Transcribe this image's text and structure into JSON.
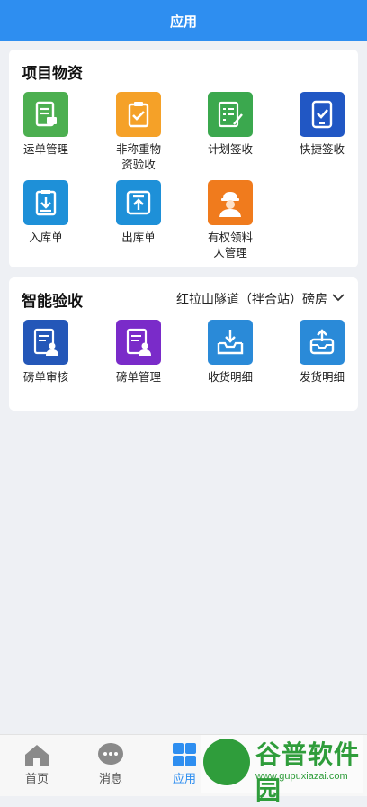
{
  "header": {
    "title": "应用"
  },
  "project_section": {
    "title": "项目物资",
    "items": [
      {
        "label": "运单管理",
        "icon": "waybill-icon",
        "color": "#4caf50"
      },
      {
        "label": "非称重物\n资验收",
        "icon": "clipboard-check-icon",
        "color": "#f5a128"
      },
      {
        "label": "计划签收",
        "icon": "checklist-edit-icon",
        "color": "#3ba84e"
      },
      {
        "label": "快捷签收",
        "icon": "tablet-check-icon",
        "color": "#2157c4"
      },
      {
        "label": "入库单",
        "icon": "inbound-clipboard-icon",
        "color": "#1e90d8"
      },
      {
        "label": "出库单",
        "icon": "outbound-upload-icon",
        "color": "#1e90d8"
      },
      {
        "label": "有权领料\n人管理",
        "icon": "worker-icon",
        "color": "#f07b1d"
      }
    ]
  },
  "smart_section": {
    "title": "智能验收",
    "site_selector": "红拉山隧道（拌合站）磅房",
    "items": [
      {
        "label": "磅单审核",
        "icon": "document-person-icon",
        "color": "#2457b8"
      },
      {
        "label": "磅单管理",
        "icon": "document-person-icon",
        "color": "#7a2bc9"
      },
      {
        "label": "收货明细",
        "icon": "tray-download-icon",
        "color": "#2a8ad8"
      },
      {
        "label": "发货明细",
        "icon": "box-upload-icon",
        "color": "#2a8ad8"
      }
    ]
  },
  "tabbar": {
    "tabs": [
      {
        "label": "首页",
        "icon": "home-icon"
      },
      {
        "label": "消息",
        "icon": "chat-icon"
      },
      {
        "label": "应用",
        "icon": "apps-grid-icon",
        "active": true
      }
    ]
  },
  "watermark": {
    "title": "谷普软件园",
    "url": "www.gupuxiazai.com"
  }
}
